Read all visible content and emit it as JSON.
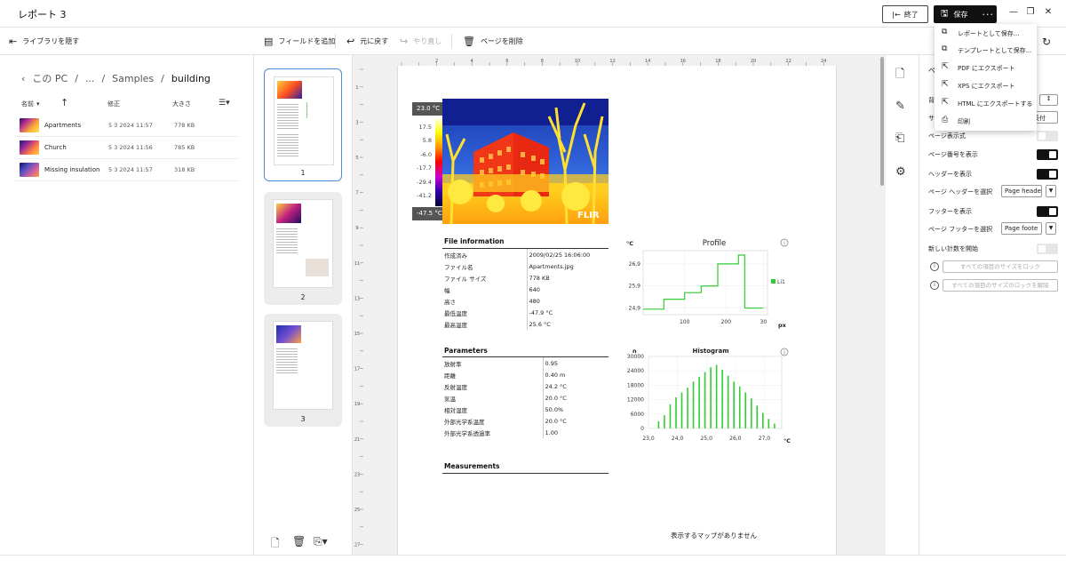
{
  "app": {
    "title": "レポート 3",
    "exit_label": "終了",
    "save_label": "保存",
    "more_label": "···"
  },
  "toolbar": {
    "hide_library": "ライブラリを隠す",
    "add_field": "フィールドを追加",
    "undo": "元に戻す",
    "redo": "やり直し",
    "delete_page": "ページを削除"
  },
  "library": {
    "breadcrumb": [
      "この PC",
      "...",
      "Samples",
      "building"
    ],
    "columns": {
      "name": "名前",
      "modified": "修正",
      "size": "大きさ"
    },
    "files": [
      {
        "name": "Apartments",
        "date": "5 3 2024 11:57",
        "size": "778 KB"
      },
      {
        "name": "Church",
        "date": "5 3 2024 11:56",
        "size": "785 KB"
      },
      {
        "name": "Missing insulation",
        "date": "5 3 2024 11:57",
        "size": "318 KB"
      }
    ]
  },
  "pages": {
    "numbers": [
      "1",
      "2",
      "3"
    ]
  },
  "report": {
    "thermal": {
      "max_label": "23.0 °C",
      "min_label": "-47.5 °C",
      "scale_ticks": [
        "17.5",
        "5.8",
        "-6.0",
        "-17.7",
        "-29.4",
        "-41.2"
      ],
      "logo": "FLIR"
    },
    "file_info": {
      "title": "File information",
      "rows": [
        [
          "作成済み",
          "2009/02/25 16:06:00"
        ],
        [
          "ファイル名",
          "Apartments.jpg"
        ],
        [
          "ファイル サイズ",
          "778 KB"
        ],
        [
          "幅",
          "640"
        ],
        [
          "高さ",
          "480"
        ],
        [
          "最低温度",
          "-47.9 °C"
        ],
        [
          "最高温度",
          "25.6 °C"
        ]
      ]
    },
    "parameters": {
      "title": "Parameters",
      "rows": [
        [
          "放射率",
          "0.95"
        ],
        [
          "距離",
          "0.40 m"
        ],
        [
          "反射温度",
          "24.2 °C"
        ],
        [
          "気温",
          "20.0 °C"
        ],
        [
          "相対湿度",
          "50.0%"
        ],
        [
          "外部光学系温度",
          "20.0 °C"
        ],
        [
          "外部光学系透過率",
          "1.00"
        ]
      ]
    },
    "measurements_title": "Measurements",
    "no_map": "表示するマップがありません"
  },
  "chart_data": [
    {
      "type": "line",
      "title": "Profile",
      "ylabel": "°C",
      "xlabel": "px",
      "x_ticks": [
        "100",
        "200",
        "30"
      ],
      "y_ticks": [
        "26,9",
        "25,9",
        "24,9"
      ],
      "legend": [
        "Li1"
      ],
      "series": [
        {
          "name": "Li1",
          "x": [
            0,
            50,
            50,
            100,
            100,
            140,
            140,
            180,
            180,
            230,
            230,
            245,
            245,
            290
          ],
          "y": [
            24.85,
            24.85,
            25.3,
            25.3,
            25.6,
            25.6,
            25.9,
            25.9,
            26.9,
            26.9,
            27.3,
            27.3,
            24.9,
            24.9
          ]
        }
      ],
      "color": "#33cc33"
    },
    {
      "type": "bar",
      "title": "Histogram",
      "ylabel": "n",
      "xlabel": "°C",
      "x_ticks": [
        "23,0",
        "24,0",
        "25,0",
        "26,0",
        "27,0"
      ],
      "y_ticks": [
        "0",
        "6000",
        "12000",
        "18000",
        "24000",
        "30000"
      ],
      "ylim": [
        0,
        30000
      ],
      "xlim": [
        23.0,
        27.6
      ],
      "x": [
        23.35,
        23.55,
        23.75,
        23.95,
        24.15,
        24.35,
        24.55,
        24.75,
        24.95,
        25.15,
        25.35,
        25.55,
        25.75,
        25.95,
        26.15,
        26.35,
        26.55,
        26.75,
        26.95,
        27.15,
        27.35
      ],
      "values": [
        3000,
        5500,
        10000,
        13000,
        15000,
        17000,
        19500,
        21500,
        23500,
        25500,
        26500,
        24500,
        22000,
        19500,
        17500,
        15000,
        12500,
        9500,
        6500,
        4000,
        2000
      ],
      "color": "#33cc33"
    }
  ],
  "right_panel": {
    "rows": [
      {
        "label": "ページ表示式",
        "toggle": false
      },
      {
        "label": "ページ番号を表示",
        "toggle": true
      },
      {
        "label": "ヘッダーを表示",
        "toggle": true
      },
      {
        "label": "ページ ヘッダーを選択",
        "select": "Page heade"
      },
      {
        "label": "フッターを表示",
        "toggle": true
      },
      {
        "label": "ページ フッターを選択",
        "select": "Page foote"
      },
      {
        "label": "新しい計数を開始",
        "toggle": false
      }
    ],
    "lock_all": "すべての項目のサイズをロック",
    "unlock_all": "すべての項目のサイズのロックを解除",
    "partial_1": "背",
    "partial_2": "サ",
    "partial_3": "長付",
    "partial_4": "ペ"
  },
  "save_menu": {
    "items": [
      {
        "icon": "save-as-icon",
        "label": "レポートとして保存..."
      },
      {
        "icon": "template-icon",
        "label": "テンプレートとして保存..."
      },
      {
        "icon": "pdf-export-icon",
        "label": "PDF にエクスポート"
      },
      {
        "icon": "xps-export-icon",
        "label": "XPS にエクスポート"
      },
      {
        "icon": "html-export-icon",
        "label": "HTML にエクスポートする"
      },
      {
        "icon": "print-icon",
        "label": "印刷"
      }
    ]
  }
}
